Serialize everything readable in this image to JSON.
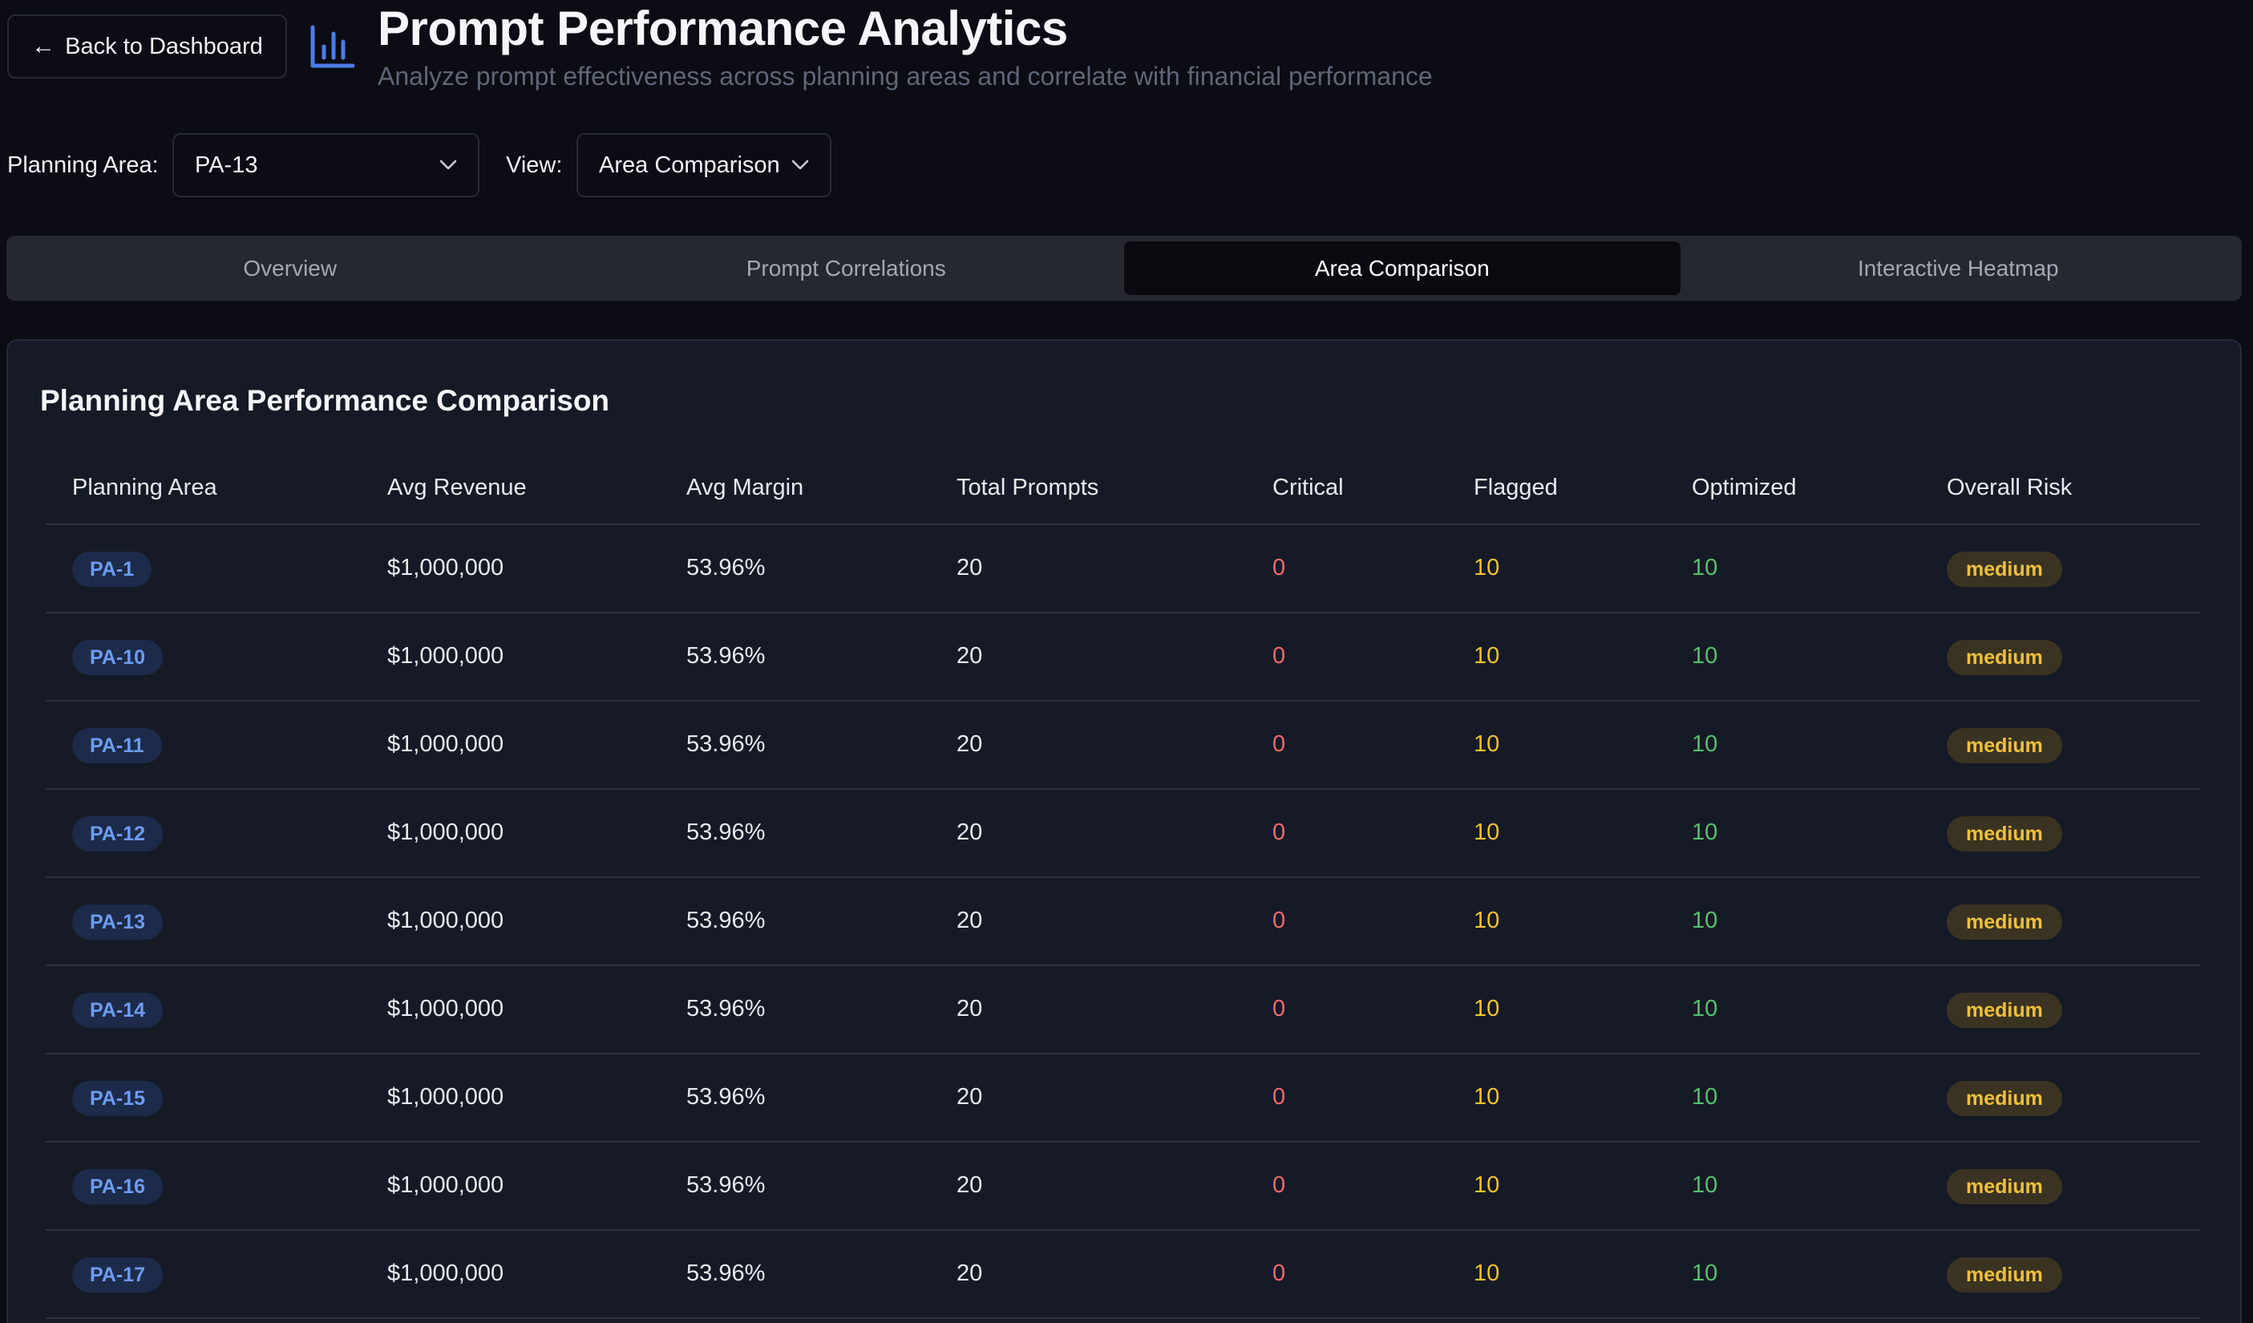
{
  "header": {
    "back_label": "Back to Dashboard",
    "title": "Prompt Performance Analytics",
    "subtitle": "Analyze prompt effectiveness across planning areas and correlate with financial performance"
  },
  "filters": {
    "planning_area_label": "Planning Area:",
    "planning_area_value": "PA-13",
    "view_label": "View:",
    "view_value": "Area Comparison"
  },
  "tabs": [
    {
      "label": "Overview",
      "active": false
    },
    {
      "label": "Prompt Correlations",
      "active": false
    },
    {
      "label": "Area Comparison",
      "active": true
    },
    {
      "label": "Interactive Heatmap",
      "active": false
    }
  ],
  "card": {
    "title": "Planning Area Performance Comparison"
  },
  "table": {
    "columns": [
      "Planning Area",
      "Avg Revenue",
      "Avg Margin",
      "Total Prompts",
      "Critical",
      "Flagged",
      "Optimized",
      "Overall Risk"
    ],
    "rows": [
      {
        "area": "PA-1",
        "revenue": "$1,000,000",
        "margin": "53.96%",
        "prompts": "20",
        "critical": "0",
        "flagged": "10",
        "optimized": "10",
        "risk": "medium"
      },
      {
        "area": "PA-10",
        "revenue": "$1,000,000",
        "margin": "53.96%",
        "prompts": "20",
        "critical": "0",
        "flagged": "10",
        "optimized": "10",
        "risk": "medium"
      },
      {
        "area": "PA-11",
        "revenue": "$1,000,000",
        "margin": "53.96%",
        "prompts": "20",
        "critical": "0",
        "flagged": "10",
        "optimized": "10",
        "risk": "medium"
      },
      {
        "area": "PA-12",
        "revenue": "$1,000,000",
        "margin": "53.96%",
        "prompts": "20",
        "critical": "0",
        "flagged": "10",
        "optimized": "10",
        "risk": "medium"
      },
      {
        "area": "PA-13",
        "revenue": "$1,000,000",
        "margin": "53.96%",
        "prompts": "20",
        "critical": "0",
        "flagged": "10",
        "optimized": "10",
        "risk": "medium"
      },
      {
        "area": "PA-14",
        "revenue": "$1,000,000",
        "margin": "53.96%",
        "prompts": "20",
        "critical": "0",
        "flagged": "10",
        "optimized": "10",
        "risk": "medium"
      },
      {
        "area": "PA-15",
        "revenue": "$1,000,000",
        "margin": "53.96%",
        "prompts": "20",
        "critical": "0",
        "flagged": "10",
        "optimized": "10",
        "risk": "medium"
      },
      {
        "area": "PA-16",
        "revenue": "$1,000,000",
        "margin": "53.96%",
        "prompts": "20",
        "critical": "0",
        "flagged": "10",
        "optimized": "10",
        "risk": "medium"
      },
      {
        "area": "PA-17",
        "revenue": "$1,000,000",
        "margin": "53.96%",
        "prompts": "20",
        "critical": "0",
        "flagged": "10",
        "optimized": "10",
        "risk": "medium"
      }
    ]
  },
  "colors": {
    "accent_blue": "#4d7ce8",
    "critical": "#ee6a6a",
    "flagged": "#f2c230",
    "optimized": "#55c06a",
    "risk_medium": "#f0c03a"
  },
  "icons": {
    "back": "arrow-left-icon",
    "header": "bar-chart-icon",
    "select": "chevron-down-icon"
  }
}
